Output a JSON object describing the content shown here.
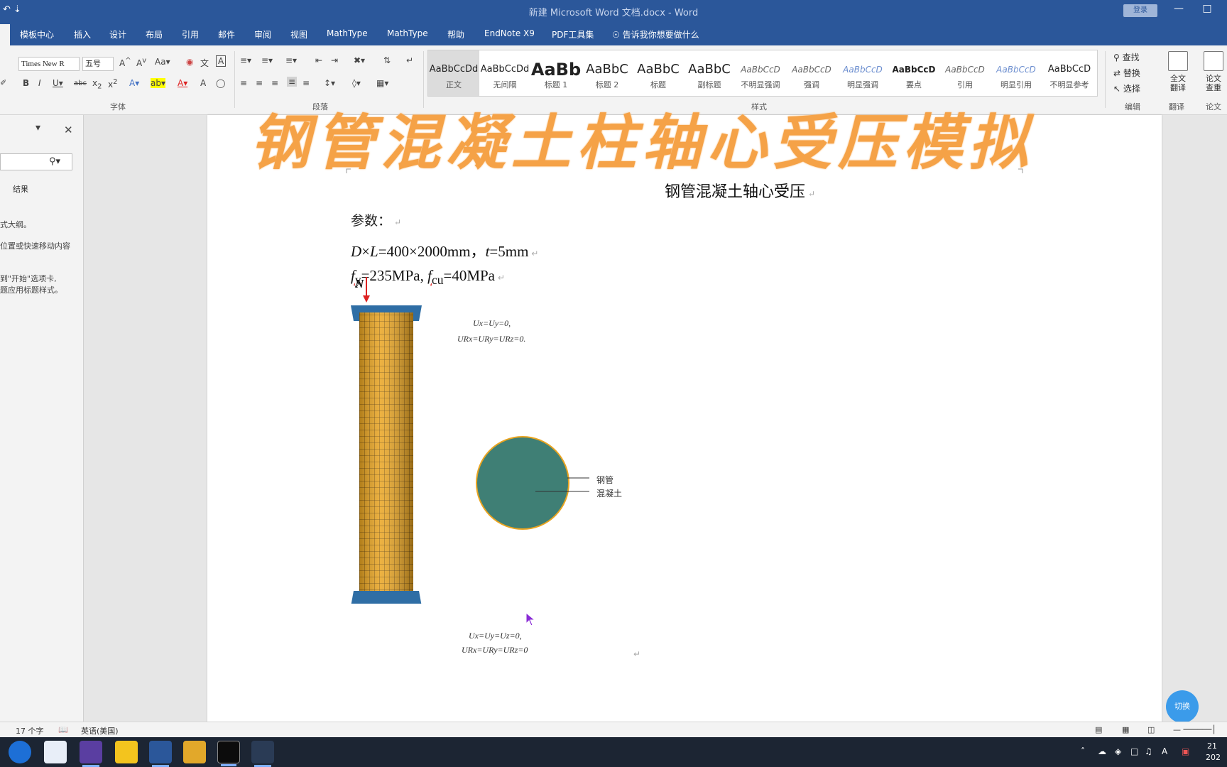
{
  "window": {
    "quick_access": "↶  ⇣",
    "title": "新建 Microsoft Word 文档.docx  -  Word",
    "login": "登录"
  },
  "menu": {
    "items": [
      "模板中心",
      "插入",
      "设计",
      "布局",
      "引用",
      "邮件",
      "审阅",
      "视图",
      "MathType",
      "MathType",
      "帮助",
      "EndNote X9",
      "PDF工具集"
    ],
    "tell_me": "告诉我你想要做什么"
  },
  "ribbon": {
    "font_name": "Times New R",
    "font_size": "五号",
    "group_font": "字体",
    "group_paragraph": "段落",
    "group_styles": "样式",
    "group_edit": "编辑",
    "group_translate": "翻译",
    "group_paper": "论文",
    "styles": [
      {
        "preview": "AaBbCcDd",
        "name": "正文",
        "selected": true,
        "kind": "normal"
      },
      {
        "preview": "AaBbCcDd",
        "name": "无间隔",
        "selected": false,
        "kind": "normal"
      },
      {
        "preview": "AaBb",
        "name": "标题 1",
        "selected": false,
        "kind": "big"
      },
      {
        "preview": "AaBbC",
        "name": "标题 2",
        "selected": false,
        "kind": "h2"
      },
      {
        "preview": "AaBbC",
        "name": "标题",
        "selected": false,
        "kind": "h2"
      },
      {
        "preview": "AaBbC",
        "name": "副标题",
        "selected": false,
        "kind": "h2"
      },
      {
        "preview": "AaBbCcD",
        "name": "不明显强调",
        "selected": false,
        "kind": "ital"
      },
      {
        "preview": "AaBbCcD",
        "name": "强调",
        "selected": false,
        "kind": "ital"
      },
      {
        "preview": "AaBbCcD",
        "name": "明显强调",
        "selected": false,
        "kind": "blue"
      },
      {
        "preview": "AaBbCcD",
        "name": "要点",
        "selected": false,
        "kind": "bold"
      },
      {
        "preview": "AaBbCcD",
        "name": "引用",
        "selected": false,
        "kind": "ital"
      },
      {
        "preview": "AaBbCcD",
        "name": "明显引用",
        "selected": false,
        "kind": "blue"
      },
      {
        "preview": "AaBbCcD",
        "name": "不明显参考",
        "selected": false,
        "kind": "normal"
      }
    ],
    "find": "查找",
    "replace": "替换",
    "select": "选择",
    "full_translate": "全文\n翻译",
    "paper_check": "论文\n查重"
  },
  "nav": {
    "tab_results": "结果",
    "hint_1": "式大纲。",
    "hint_2": "位置或快速移动内容",
    "hint_3": "到\"开始\"选项卡,",
    "hint_4": "题应用标题样式。"
  },
  "document": {
    "overlay_title": "钢管混凝土柱轴心受压模拟",
    "title": "钢管混凝土轴心受压",
    "params_label": "参数：",
    "line1_a": "D",
    "line1_b": "×",
    "line1_c": "L",
    "line1_d": "=400×2000mm，",
    "line1_e": "t",
    "line1_f": "=5mm",
    "line2_a": "f",
    "line2_a_sub": "y",
    "line2_b": "=235MPa, ",
    "line2_c": "f",
    "line2_c_sub": "cu",
    "line2_d": "=40MPa",
    "load_label": "N",
    "top_bc_1": "Ux=Uy=0,",
    "top_bc_2": "URx=URy=URz=0.",
    "bottom_bc_1": "Ux=Uy=Uz=0,",
    "bottom_bc_2": "URx=URy=URz=0",
    "legend_steel": "钢管",
    "legend_concrete": "混凝土"
  },
  "status": {
    "words": "17 个字",
    "lang": "英语(美国)"
  },
  "float_button": "切换",
  "tray": {
    "ime": "A",
    "time": "21",
    "date": "202"
  },
  "colors": {
    "word_blue": "#2b579a",
    "column_orange": "#e9a420",
    "plate_blue": "#2f6ea5",
    "section_teal": "#3f7f75",
    "overlay_orange": "#f5a247"
  }
}
